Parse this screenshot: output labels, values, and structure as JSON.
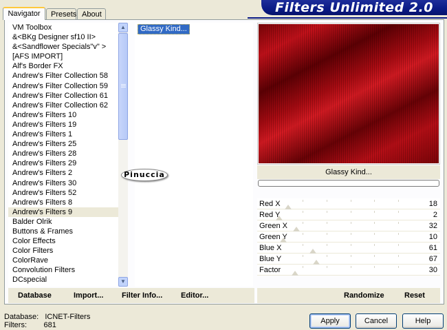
{
  "tabs": [
    {
      "label": "Navigator",
      "active": true
    },
    {
      "label": "Presets",
      "active": false
    },
    {
      "label": "About",
      "active": false
    }
  ],
  "title": "Filters Unlimited 2.0",
  "categories": [
    "VM Toolbox",
    "&<BKg Designer sf10 II>",
    "&<Sandflower Specials\"v\" >",
    "[AFS IMPORT]",
    "Alf's Border FX",
    "Andrew's Filter Collection 58",
    "Andrew's Filter Collection 59",
    "Andrew's Filter Collection 61",
    "Andrew's Filter Collection 62",
    "Andrew's Filters 10",
    "Andrew's Filters 19",
    "Andrew's Filters 1",
    "Andrew's Filters 25",
    "Andrew's Filters 28",
    "Andrew's Filters 29",
    "Andrew's Filters 2",
    "Andrew's Filters 30",
    "Andrew's Filters 52",
    "Andrew's Filters 8",
    "Andrew's Filters 9",
    "Balder Olrik",
    "Buttons & Frames",
    "Color Effects",
    "Color Filters",
    "ColorRave",
    "Convolution Filters",
    "DCspecial"
  ],
  "selected_category": "Andrew's Filters 9",
  "filters": [
    "Glassy Kind..."
  ],
  "watermark": "Pinuccia",
  "preview": {
    "filter_name": "Glassy Kind...",
    "progress": 0
  },
  "params": [
    {
      "label": "Red X",
      "value": "18",
      "level": 18
    },
    {
      "label": "Red Y",
      "value": "2",
      "level": 2
    },
    {
      "label": "Green X",
      "value": "32",
      "level": 32
    },
    {
      "label": "Green Y",
      "value": "10",
      "level": 10
    },
    {
      "label": "Blue X",
      "value": "61",
      "level": 61
    },
    {
      "label": "Blue Y",
      "value": "67",
      "level": 67
    },
    {
      "label": "Factor",
      "value": "30",
      "level": 30
    }
  ],
  "toolbar": {
    "database": "Database",
    "import": "Import...",
    "filter_info": "Filter Info...",
    "editor": "Editor...",
    "randomize": "Randomize",
    "reset": "Reset"
  },
  "status": {
    "database_label": "Database:",
    "database_value": "ICNET-Filters",
    "filters_label": "Filters:",
    "filters_value": "681"
  },
  "buttons": {
    "apply": "Apply",
    "cancel": "Cancel",
    "help": "Help"
  }
}
